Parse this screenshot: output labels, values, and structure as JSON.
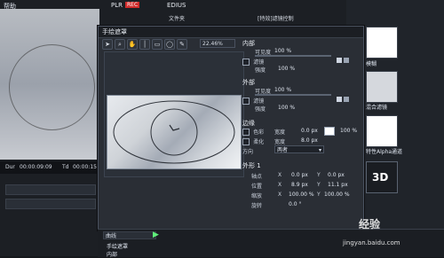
{
  "left_panel": {
    "menu_help": "帮助",
    "plr": "PLR",
    "rec": "REC",
    "timecode_label": "Dur",
    "timecode_value": "00:00:09:09",
    "td_label": "Td",
    "td_value": "00:00:15"
  },
  "top_panel": {
    "app": "EDIUS",
    "file_column": "文件夹",
    "clip_label": "[特效]滤镜控制"
  },
  "dialog": {
    "title": "手绘遮罩",
    "zoom": "22.46%",
    "inner": {
      "title": "内部",
      "visibility_label": "可见度",
      "visibility_value": "100 %",
      "filter_label": "滤镜",
      "strength_label": "强度",
      "strength_value": "100 %"
    },
    "outer": {
      "title": "外部",
      "visibility_label": "可见度",
      "visibility_value": "100 %",
      "filter_label": "滤镜",
      "strength_label": "强度",
      "strength_value": "100 %"
    },
    "edge": {
      "title": "边缘",
      "color_label": "色彩",
      "width_label": "宽度",
      "width_value": "0.0 px",
      "percent_value": "100 %",
      "soften_label": "柔化",
      "soften_width_label": "宽度",
      "soften_width_value": "8.0 px",
      "direction_label": "方向",
      "direction_value": "两者"
    },
    "shape": {
      "title": "外形 1",
      "axis_label": "轴点",
      "pos_label": "位置",
      "scale_label": "缩放",
      "rotate_label": "旋转",
      "x_label": "X",
      "y_label": "Y",
      "axis_x": "0.0 px",
      "axis_y": "0.0 px",
      "pos_x": "8.9 px",
      "pos_y": "11.1 px",
      "scale_x": "100.00 %",
      "scale_y": "100.00 %",
      "rotate_value": "0.0 °"
    }
  },
  "timeline": {
    "mode_label": "曲线",
    "track1": "手绘遮罩",
    "track2": "内部"
  },
  "right_effects": {
    "blur": "模糊",
    "mix_filter": "混合滤镜",
    "alpha": "特性Alpha通道",
    "three_d": "3D"
  },
  "watermark": {
    "site": "jingyan.baidu.com",
    "brand": "经验"
  }
}
